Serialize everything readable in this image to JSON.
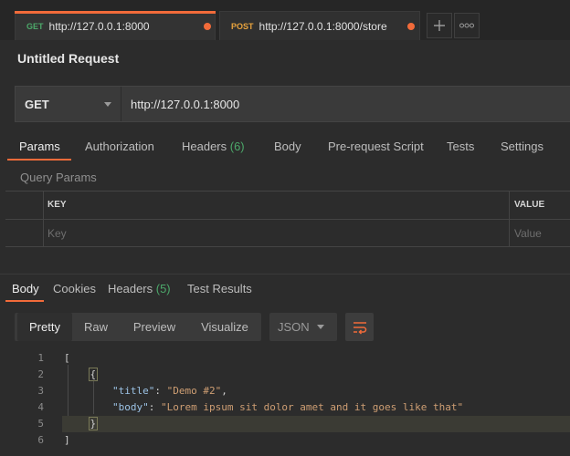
{
  "tabs": [
    {
      "method": "GET",
      "method_color": "#4ca86a",
      "url": "http://127.0.0.1:8000",
      "active": true
    },
    {
      "method": "POST",
      "method_color": "#e8a33d",
      "url": "http://127.0.0.1:8000/store",
      "active": false
    }
  ],
  "tab_actions": {
    "new_tab": "+",
    "more": "ooo"
  },
  "request": {
    "title": "Untitled Request",
    "method": "GET",
    "url": "http://127.0.0.1:8000"
  },
  "request_tabs": [
    {
      "label": "Params",
      "active": true
    },
    {
      "label": "Authorization"
    },
    {
      "label": "Headers ",
      "count": "(6)"
    },
    {
      "label": "Body"
    },
    {
      "label": "Pre-request Script"
    },
    {
      "label": "Tests"
    },
    {
      "label": "Settings"
    }
  ],
  "query_params": {
    "title": "Query Params",
    "columns": [
      "KEY",
      "VALUE"
    ],
    "key_placeholder": "Key",
    "value_placeholder": "Value"
  },
  "response_tabs": [
    {
      "label": "Body",
      "active": true
    },
    {
      "label": "Cookies"
    },
    {
      "label": "Headers ",
      "count": "(5)"
    },
    {
      "label": "Test Results"
    }
  ],
  "view_modes": [
    "Pretty",
    "Raw",
    "Preview",
    "Visualize"
  ],
  "active_view": "Pretty",
  "format": "JSON",
  "response_body": {
    "line_numbers": [
      "1",
      "2",
      "3",
      "4",
      "5",
      "6"
    ],
    "title_key": "\"title\"",
    "title_value": "\"Demo #2\"",
    "body_key": "\"body\"",
    "body_value": "\"Lorem ipsum sit dolor amet and it goes like that\"",
    "highlighted_line": 5
  },
  "colors": {
    "accent": "#f26b3a",
    "get": "#4ca86a",
    "post": "#e8a33d",
    "json_key": "#9cc3e6",
    "json_string": "#ce9e73"
  }
}
